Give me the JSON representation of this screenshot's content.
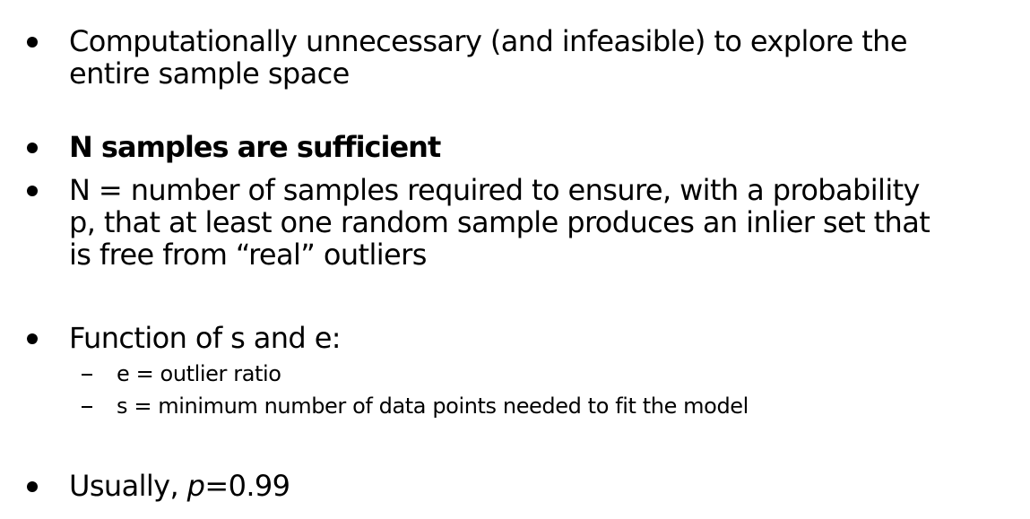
{
  "bullets": [
    {
      "lines": [
        "Computationally unnecessary (and infeasible) to explore the",
        "entire sample space"
      ]
    },
    {
      "text": "N samples are sufficient"
    },
    {
      "lines": [
        "N = number of samples required to ensure, with a probability",
        "p, that at least one random sample produces an inlier set that",
        "is free from “real” outliers"
      ]
    },
    {
      "text": "Function of s and e:",
      "subitems": [
        "e = outlier ratio",
        "s = minimum number of data points needed to fit the model"
      ]
    },
    {
      "prefix": "Usually, ",
      "emph": "p",
      "suffix": "=0.99"
    }
  ]
}
